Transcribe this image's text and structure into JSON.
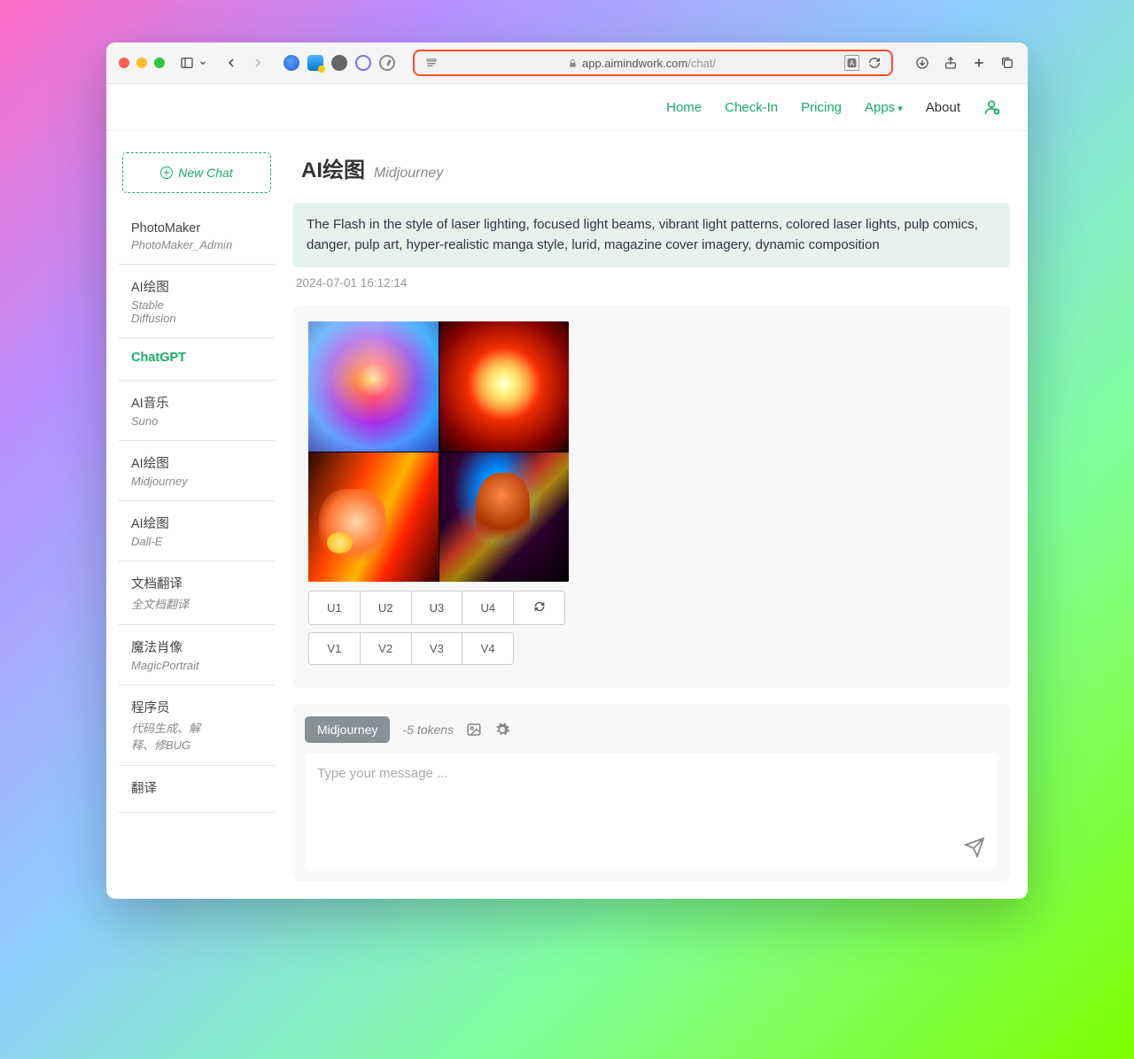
{
  "url": {
    "domain": "app.aimindwork.com",
    "path": "/chat/"
  },
  "nav": {
    "home": "Home",
    "checkin": "Check-In",
    "pricing": "Pricing",
    "apps": "Apps",
    "about": "About"
  },
  "sidebar": {
    "new_chat": "New Chat",
    "items": [
      {
        "title": "PhotoMaker",
        "sub": "PhotoMaker_Admin"
      },
      {
        "title": "AI绘图",
        "sub": "Stable Diffusion"
      },
      {
        "title": "ChatGPT",
        "sub": ""
      },
      {
        "title": "AI音乐",
        "sub": "Suno"
      },
      {
        "title": "AI绘图",
        "sub": "Midjourney"
      },
      {
        "title": "AI绘图",
        "sub": "Dall-E"
      },
      {
        "title": "文档翻译",
        "sub": "全文档翻译"
      },
      {
        "title": "魔法肖像",
        "sub": "MagicPortrait"
      },
      {
        "title": "程序员",
        "sub": "代码生成、解释、修BUG"
      },
      {
        "title": "翻译",
        "sub": ""
      }
    ]
  },
  "page": {
    "title": "AI绘图",
    "subtitle": "Midjourney",
    "prompt": "The Flash in the style of laser lighting, focused light beams, vibrant light patterns, colored laser lights, pulp comics, danger, pulp art, hyper-realistic manga style, lurid, magazine cover imagery, dynamic composition",
    "timestamp": "2024-07-01 16:12:14"
  },
  "buttons": {
    "u1": "U1",
    "u2": "U2",
    "u3": "U3",
    "u4": "U4",
    "v1": "V1",
    "v2": "V2",
    "v3": "V3",
    "v4": "V4"
  },
  "input": {
    "model": "Midjourney",
    "tokens": "-5 tokens",
    "placeholder": "Type your message ..."
  }
}
